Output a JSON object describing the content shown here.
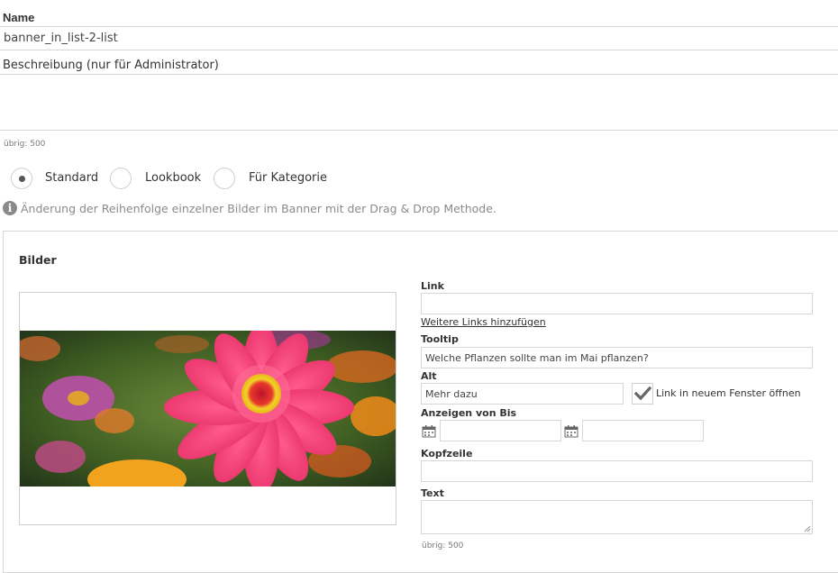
{
  "name_field": {
    "label": "Name",
    "value": "banner_in_list-2-list"
  },
  "description_field": {
    "label": "Beschreibung (nur für Administrator)",
    "value": "",
    "remaining": "übrig: 500"
  },
  "banner_type": {
    "options": [
      "Standard",
      "Lookbook",
      "Für Kategorie"
    ],
    "selected": "Standard"
  },
  "info_note": "Änderung der Reihenfolge einzelner Bilder im Banner mit der Drag & Drop Methode.",
  "images_panel": {
    "title": "Bilder",
    "image": {
      "subject": "pink zinnia flower photo"
    },
    "link": {
      "label": "Link",
      "value": ""
    },
    "more_links": "Weitere Links hinzufügen",
    "tooltip": {
      "label": "Tooltip",
      "value": "Welche Pflanzen sollte man im Mai pflanzen?"
    },
    "alt": {
      "label": "Alt",
      "value": "Mehr dazu"
    },
    "new_window": {
      "label": "Link in neuem Fenster öffnen",
      "checked": true
    },
    "display_range": {
      "label": "Anzeigen von Bis",
      "from": "",
      "to": ""
    },
    "headline": {
      "label": "Kopfzeile",
      "value": ""
    },
    "text": {
      "label": "Text",
      "value": "",
      "remaining": "übrig: 500"
    }
  },
  "colors": {
    "border": "#d6d6d6",
    "text": "#333333",
    "muted": "#777777",
    "selected_dot": "#555555"
  }
}
